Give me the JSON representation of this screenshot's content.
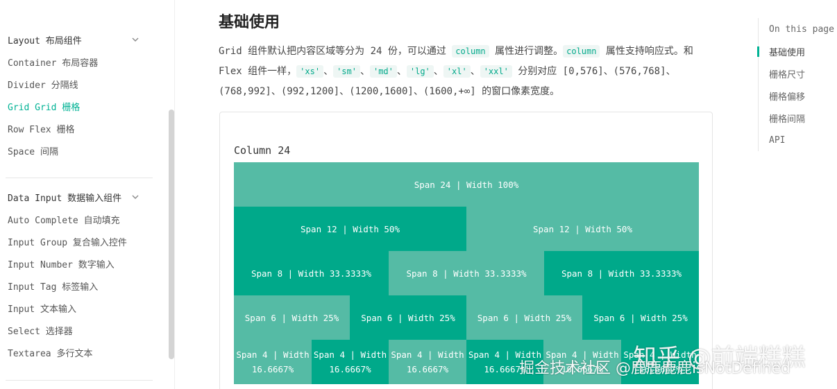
{
  "sidebar": {
    "layout_group": {
      "label": "Layout 布局组件",
      "items": [
        "Container 布局容器",
        "Divider 分隔线",
        "Grid Grid 栅格",
        "Row Flex 栅格",
        "Space 间隔"
      ],
      "active_index": 2
    },
    "input_group": {
      "label": "Data Input 数据输入组件",
      "items": [
        "Auto Complete 自动填充",
        "Input Group 复合输入控件",
        "Input Number 数字输入",
        "Input Tag 标签输入",
        "Input 文本输入",
        "Select 选择器",
        "Textarea 多行文本"
      ]
    }
  },
  "main": {
    "heading": "基础使用",
    "para": {
      "p1": "Grid 组件默认把内容区域等分为 24 份，可以通过 ",
      "code1": "column",
      "p2": " 属性进行调整。",
      "code2": "column",
      "p3": " 属性支持响应式。和 Flex 组件一样，",
      "bp": [
        "'xs'",
        "'sm'",
        "'md'",
        "'lg'",
        "'xl'",
        "'xxl'"
      ],
      "sep": "、",
      "p4": " 分别对应 [0,576]、(576,768]、(768,992]、(992,1200]、(1200,1600]、(1600,+∞] 的窗口像素宽度。"
    },
    "demo": {
      "title": "Column 24",
      "rows": [
        [
          "Span 24 | Width 100%"
        ],
        [
          "Span 12 | Width 50%",
          "Span 12 | Width 50%"
        ],
        [
          "Span 8 | Width 33.3333%",
          "Span 8 | Width 33.3333%",
          "Span 8 | Width 33.3333%"
        ],
        [
          "Span 6 | Width 25%",
          "Span 6 | Width 25%",
          "Span 6 | Width 25%",
          "Span 6 | Width 25%"
        ],
        [
          "Span 4 | Width 16.6667%",
          "Span 4 | Width 16.6667%",
          "Span 4 | Width 16.6667%",
          "Span 4 | Width 16.6667%",
          "Span 4 | Width 16.6667%",
          "Span 4 | Width 16.6667%"
        ]
      ]
    }
  },
  "toc": {
    "title": "On this page",
    "items": [
      "基础使用",
      "栅格尺寸",
      "栅格偏移",
      "栅格间隔",
      "API"
    ],
    "active_index": 0
  },
  "watermark": {
    "line1": "知乎 @前端糕糕",
    "line2": "掘金技术社区 @鹿鹿鹿鹿isNotDefined"
  },
  "colors": {
    "accent": "#00b294",
    "col_light": "#55bba5",
    "col_dark": "#00a98a"
  }
}
